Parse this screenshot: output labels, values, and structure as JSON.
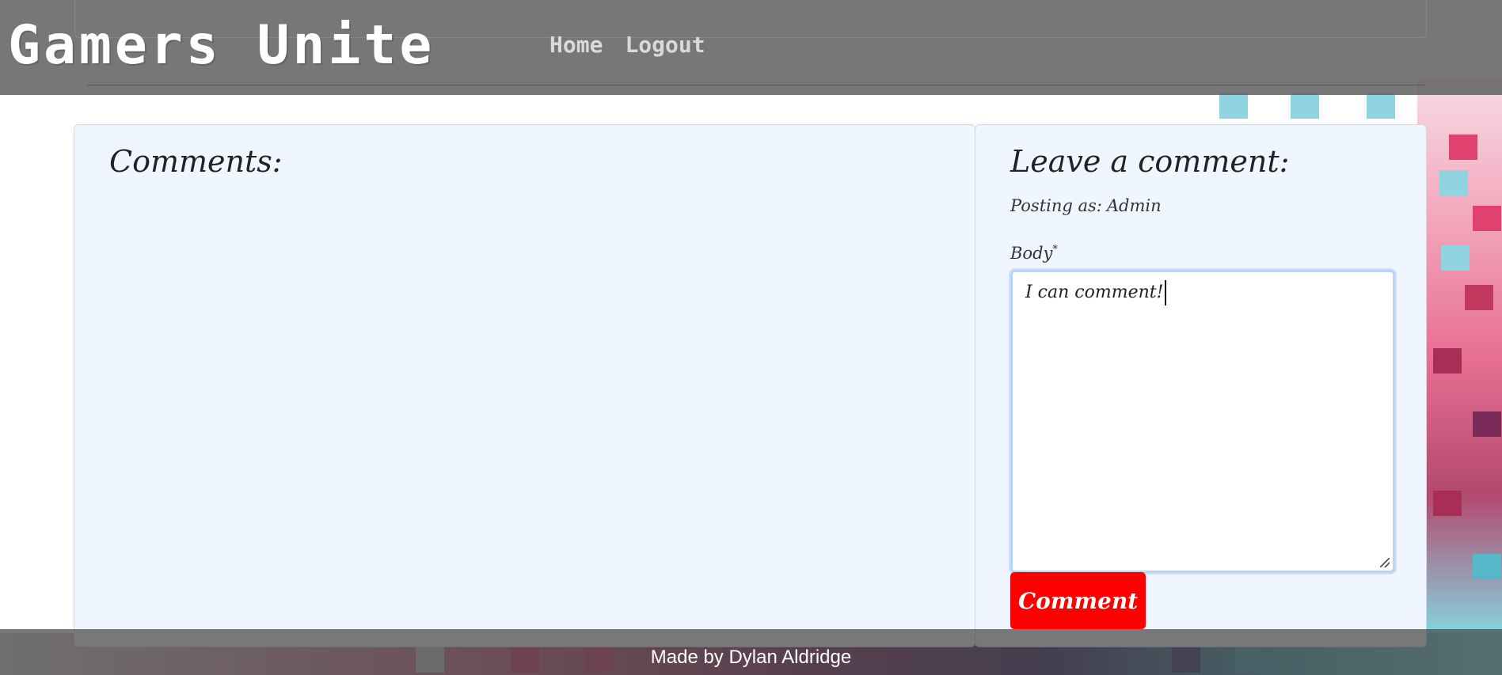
{
  "header": {
    "brand": "Gamers Unite",
    "nav": [
      {
        "label": "Home"
      },
      {
        "label": "Logout"
      }
    ]
  },
  "comments_panel": {
    "title": "Comments:"
  },
  "comment_form": {
    "title": "Leave a comment:",
    "posting_as_label": "Posting as:",
    "posting_as_user": "Admin",
    "body_label": "Body",
    "required_marker": "*",
    "body_value": "I can comment!",
    "submit_label": "Comment"
  },
  "footer": {
    "credit": "Made by Dylan Aldridge"
  }
}
